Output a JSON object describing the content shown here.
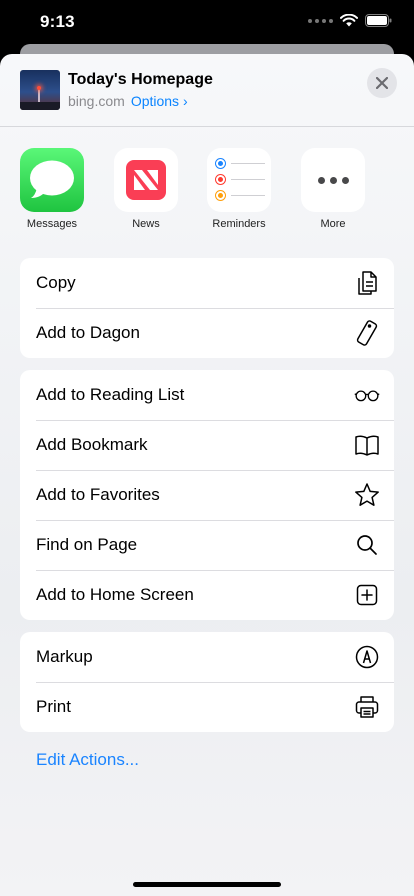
{
  "status_bar": {
    "time": "9:13"
  },
  "header": {
    "title": "Today's Homepage",
    "domain": "bing.com",
    "options_label": "Options ›"
  },
  "apps": [
    {
      "label": "Messages",
      "icon": "messages-icon"
    },
    {
      "label": "News",
      "icon": "news-icon"
    },
    {
      "label": "Reminders",
      "icon": "reminders-icon"
    },
    {
      "label": "More",
      "icon": "more-icon"
    }
  ],
  "groups": [
    [
      {
        "label": "Copy",
        "icon": "copy-icon"
      },
      {
        "label": "Add to Dagon",
        "icon": "dagon-icon"
      }
    ],
    [
      {
        "label": "Add to Reading List",
        "icon": "glasses-icon"
      },
      {
        "label": "Add Bookmark",
        "icon": "book-icon"
      },
      {
        "label": "Add to Favorites",
        "icon": "star-icon"
      },
      {
        "label": "Find on Page",
        "icon": "search-icon"
      },
      {
        "label": "Add to Home Screen",
        "icon": "plus-square-icon"
      }
    ],
    [
      {
        "label": "Markup",
        "icon": "markup-icon"
      },
      {
        "label": "Print",
        "icon": "printer-icon"
      }
    ]
  ],
  "edit_actions_label": "Edit Actions...",
  "colors": {
    "accent": "#0a84ff",
    "messages_green": "#34c759",
    "news_red": "#fa3e55"
  }
}
